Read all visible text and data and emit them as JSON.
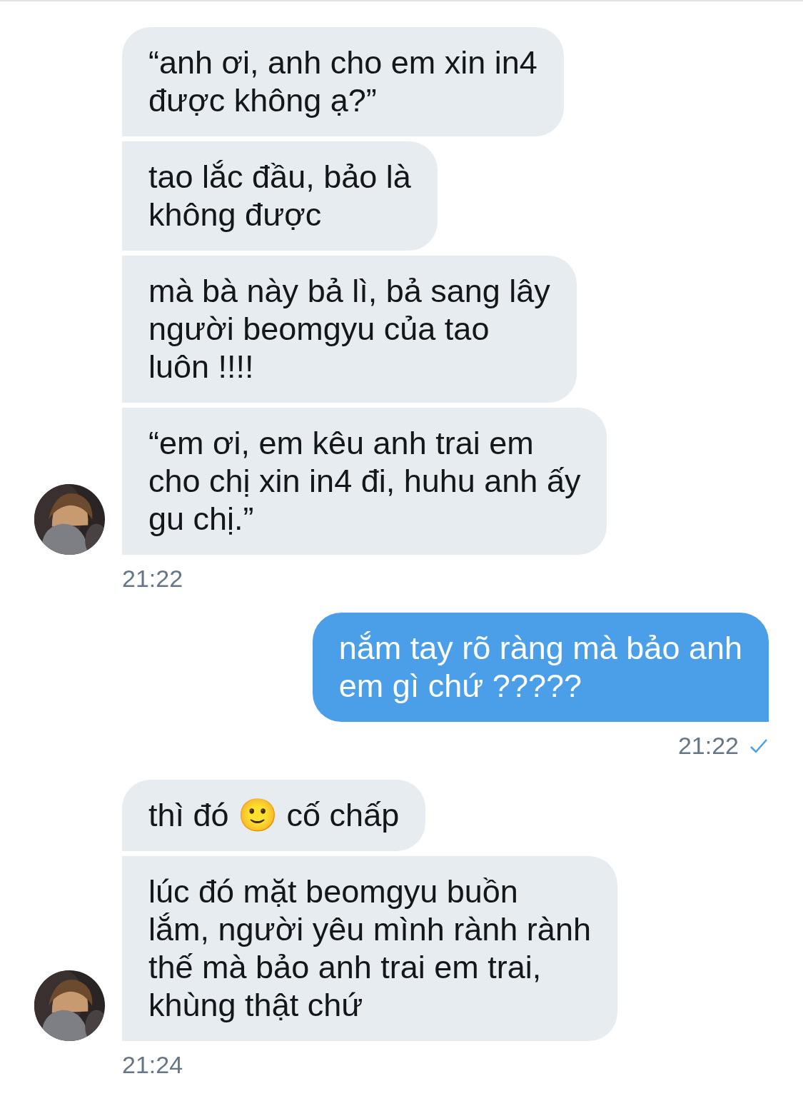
{
  "groups": [
    {
      "kind": "received",
      "time": "21:22",
      "messages": [
        "“anh ơi, anh cho em xin in4\nđược không ạ?”",
        "tao lắc đầu, bảo là\nkhông được",
        "mà bà này bả lì, bả sang lây\nngười beomgyu của tao\nluôn !!!!",
        "“em ơi, em kêu anh trai em\ncho chị xin in4 đi, huhu anh ấy\ngu chị.”"
      ]
    },
    {
      "kind": "sent",
      "read": true,
      "time": "21:22",
      "messages": [
        "nắm tay rõ ràng mà bảo anh\nem gì chứ ?????"
      ]
    },
    {
      "kind": "received",
      "time": "21:24",
      "messages": [
        "thì đó 🙂 cố chấp",
        "lúc đó mặt beomgyu buồn\nlắm, người yêu mình rành rành\nthế mà bảo anh trai em trai,\nkhùng thật chứ"
      ]
    }
  ]
}
